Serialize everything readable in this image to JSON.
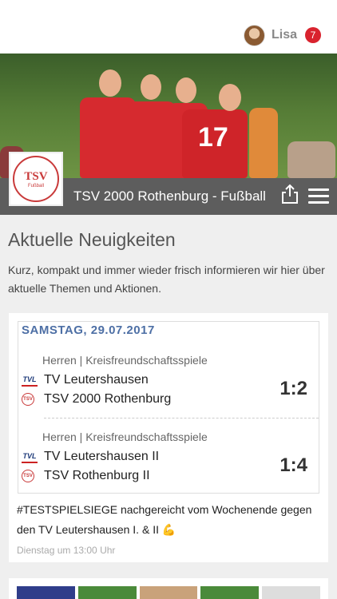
{
  "user": {
    "name": "Lisa",
    "notification_count": "7"
  },
  "club": {
    "logo_text": "TSV",
    "logo_sub": "Fußball",
    "title": "TSV 2000 Rothenburg - Fußball"
  },
  "hero": {
    "jersey_number": "17"
  },
  "section": {
    "title": "Aktuelle Neuigkeiten",
    "description": "Kurz, kompakt und immer wieder frisch informieren wir hier über aktuelle Themen und Aktionen."
  },
  "post": {
    "date": "SAMSTAG, 29.07.2017",
    "games": [
      {
        "category": "Herren | Kreisfreundschaftsspiele",
        "home": "TV Leutershausen",
        "away": "TSV 2000 Rothenburg",
        "score": "1:2"
      },
      {
        "category": "Herren | Kreisfreundschaftsspiele",
        "home": "TV Leutershausen II",
        "away": "TSV Rothenburg II",
        "score": "1:4"
      }
    ],
    "text": "#TESTSPIELSIEGE nachgereicht vom Wochenende gegen den TV Leutershausen I. & II 💪",
    "time": "Dienstag um 13:00 Uhr"
  },
  "colors": {
    "accent": "#d9232e",
    "titlebar": "#5d5d5d",
    "date_blue": "#4d6fa5"
  }
}
